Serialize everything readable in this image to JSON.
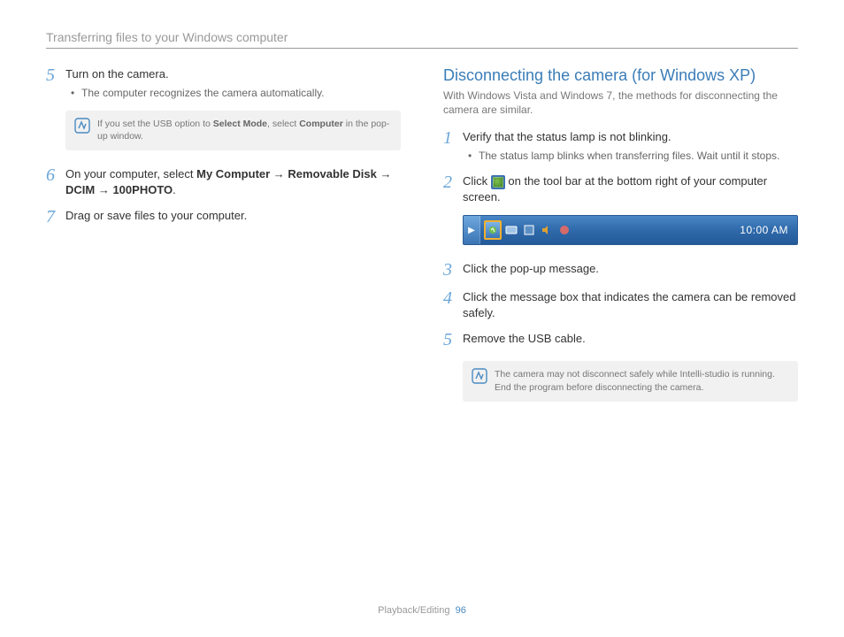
{
  "header": {
    "title": "Transferring files to your Windows computer"
  },
  "footer": {
    "section": "Playback/Editing",
    "page": "96"
  },
  "left": {
    "step5": {
      "num": "5",
      "text": "Turn on the camera.",
      "bullets": [
        "The computer recognizes the camera automatically."
      ]
    },
    "note1": {
      "pre": "If you set the USB option to ",
      "b1": "Select Mode",
      "mid": ", select ",
      "b2": "Computer",
      "post": " in the pop-up window."
    },
    "step6": {
      "num": "6",
      "pre": "On your computer, select ",
      "b1": "My Computer",
      "a1": " → ",
      "b2": "Removable Disk",
      "a2": " → ",
      "b3": "DCIM",
      "a3": " → ",
      "b4": "100PHOTO",
      "post": "."
    },
    "step7": {
      "num": "7",
      "text": "Drag or save files to your computer."
    }
  },
  "right": {
    "heading": "Disconnecting the camera (for Windows XP)",
    "sub": "With Windows Vista and Windows 7, the methods for disconnecting the camera are similar.",
    "step1": {
      "num": "1",
      "text": "Verify that the status lamp is not blinking.",
      "bullets": [
        "The status lamp blinks when transferring files. Wait until it stops."
      ]
    },
    "step2": {
      "num": "2",
      "pre": "Click ",
      "post": " on the tool bar at the bottom right of your computer screen."
    },
    "taskbar": {
      "time": "10:00 AM"
    },
    "step3": {
      "num": "3",
      "text": "Click the pop-up message."
    },
    "step4": {
      "num": "4",
      "text": "Click the message box that indicates the camera can be removed safely."
    },
    "step5": {
      "num": "5",
      "text": "Remove the USB cable."
    },
    "note2": {
      "text": "The camera may not disconnect safely while Intelli-studio is running. End the program before disconnecting the camera."
    }
  }
}
